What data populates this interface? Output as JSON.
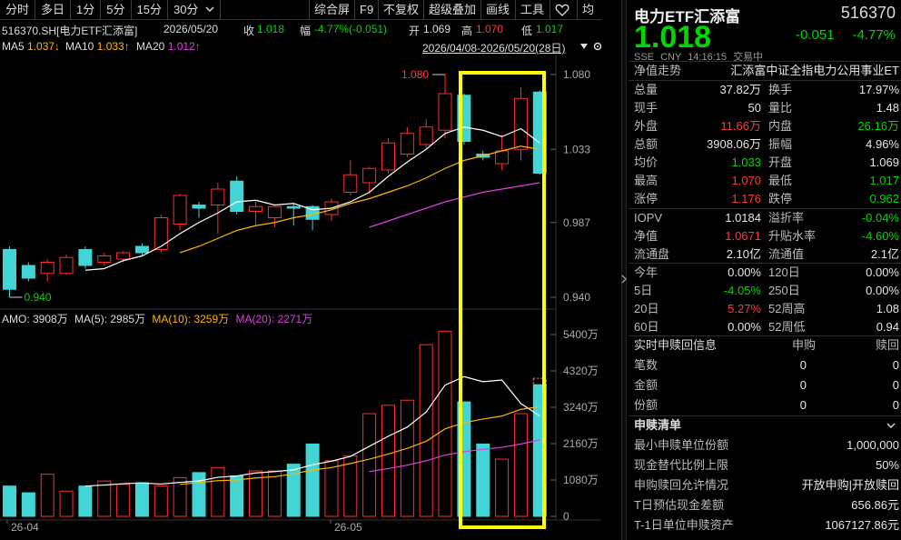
{
  "toolbar": {
    "periods": [
      "分时",
      "多日",
      "1分",
      "5分",
      "15分",
      "30分"
    ],
    "period_dropdown_icon": "chevron-down",
    "tools": [
      "综合屏",
      "F9",
      "不复权",
      "超级叠加",
      "画线",
      "工具"
    ],
    "heart_icon": "heart-outline",
    "mode_label": "均"
  },
  "info": {
    "code": "516370.SH[电力ETF汇添富]",
    "date": "2026/05/20",
    "close_label": "收",
    "close": "1.018",
    "amp_label": "幅",
    "amp": "-4.77%(-0.051)",
    "open_label": "开",
    "open": "1.069",
    "high_label": "高",
    "high": "1.070",
    "low_label": "低",
    "low": "1.017"
  },
  "ma": {
    "ma5": "MA5 1.037↓",
    "ma10": "MA10 1.033↑",
    "ma20": "MA20 1.012↑",
    "range": "2026/04/08-2026/05/20(28日)",
    "range_dropdown_icon": "triangle-down",
    "settings_icon": "gear",
    "colors": {
      "ma5": "#ffffff",
      "ma10": "#ffb400",
      "ma20": "#e040e0"
    }
  },
  "price_axis": [
    "1.080",
    "1.033",
    "0.987",
    "0.940"
  ],
  "vol_axis": [
    "5400万",
    "4320万",
    "3240万",
    "2160万",
    "1080万",
    "0"
  ],
  "date_labels": [
    "26-04",
    "26-05"
  ],
  "amo": {
    "amo": "AMO: 3908万",
    "ma5": "MA(5): 2985万",
    "ma10": "MA(10): 3259万",
    "ma20": "MA(20): 2271万"
  },
  "colors": {
    "up": "#ff2d2d",
    "down": "#43d5d5",
    "highlight": "#ffff00",
    "bg": "#000000"
  },
  "chart_data": {
    "type": "candlestick",
    "y_range": [
      0.93,
      1.09
    ],
    "annotations": {
      "high": "1.080",
      "low": "0.940"
    },
    "candles": [
      {
        "o": 0.97,
        "c": 0.945,
        "h": 0.972,
        "l": 0.94
      },
      {
        "o": 0.96,
        "c": 0.952,
        "h": 0.962,
        "l": 0.95
      },
      {
        "o": 0.955,
        "c": 0.962,
        "h": 0.964,
        "l": 0.95
      },
      {
        "o": 0.955,
        "c": 0.965,
        "h": 0.967,
        "l": 0.954
      },
      {
        "o": 0.97,
        "c": 0.96,
        "h": 0.972,
        "l": 0.958
      },
      {
        "o": 0.962,
        "c": 0.966,
        "h": 0.968,
        "l": 0.96
      },
      {
        "o": 0.964,
        "c": 0.968,
        "h": 0.969,
        "l": 0.962
      },
      {
        "o": 0.972,
        "c": 0.968,
        "h": 0.974,
        "l": 0.966
      },
      {
        "o": 0.97,
        "c": 0.99,
        "h": 0.992,
        "l": 0.968
      },
      {
        "o": 0.986,
        "c": 1.004,
        "h": 1.005,
        "l": 0.982
      },
      {
        "o": 0.998,
        "c": 0.996,
        "h": 1.0,
        "l": 0.99
      },
      {
        "o": 0.998,
        "c": 1.008,
        "h": 1.012,
        "l": 0.98
      },
      {
        "o": 1.013,
        "c": 0.994,
        "h": 1.016,
        "l": 0.992
      },
      {
        "o": 0.994,
        "c": 0.997,
        "h": 1.0,
        "l": 0.985
      },
      {
        "o": 0.99,
        "c": 0.997,
        "h": 0.998,
        "l": 0.984
      },
      {
        "o": 0.997,
        "c": 0.996,
        "h": 0.999,
        "l": 0.985
      },
      {
        "o": 0.997,
        "c": 0.989,
        "h": 0.998,
        "l": 0.982
      },
      {
        "o": 0.992,
        "c": 1.0,
        "h": 1.002,
        "l": 0.988
      },
      {
        "o": 1.006,
        "c": 1.017,
        "h": 1.026,
        "l": 1.004
      },
      {
        "o": 1.012,
        "c": 1.021,
        "h": 1.022,
        "l": 1.005
      },
      {
        "o": 1.02,
        "c": 1.037,
        "h": 1.04,
        "l": 1.018
      },
      {
        "o": 1.03,
        "c": 1.043,
        "h": 1.047,
        "l": 1.028
      },
      {
        "o": 1.036,
        "c": 1.047,
        "h": 1.052,
        "l": 1.034
      },
      {
        "o": 1.045,
        "c": 1.068,
        "h": 1.08,
        "l": 1.04
      },
      {
        "o": 1.067,
        "c": 1.038,
        "h": 1.068,
        "l": 1.036
      },
      {
        "o": 1.03,
        "c": 1.028,
        "h": 1.032,
        "l": 1.026
      },
      {
        "o": 1.024,
        "c": 1.032,
        "h": 1.042,
        "l": 1.02
      },
      {
        "o": 1.033,
        "c": 1.065,
        "h": 1.072,
        "l": 1.026
      },
      {
        "o": 1.069,
        "c": 1.018,
        "h": 1.07,
        "l": 1.017
      }
    ],
    "ma5": [
      null,
      null,
      null,
      null,
      0.957,
      0.958,
      0.963,
      0.966,
      0.972,
      0.98,
      0.987,
      0.993,
      1.0,
      1.001,
      0.998,
      0.999,
      0.995,
      0.996,
      1.0,
      1.006,
      1.016,
      1.025,
      1.033,
      1.043,
      1.047,
      1.045,
      1.041,
      1.046,
      1.037
    ],
    "ma10": [
      null,
      null,
      null,
      null,
      null,
      null,
      null,
      null,
      null,
      0.968,
      0.972,
      0.977,
      0.982,
      0.985,
      0.987,
      0.99,
      0.992,
      0.995,
      0.999,
      1.002,
      1.006,
      1.01,
      1.015,
      1.021,
      1.026,
      1.029,
      1.032,
      1.035,
      1.033
    ],
    "ma20": [
      null,
      null,
      null,
      null,
      null,
      null,
      null,
      null,
      null,
      null,
      null,
      null,
      null,
      null,
      null,
      null,
      null,
      null,
      null,
      0.984,
      0.988,
      0.992,
      0.996,
      1.0,
      1.003,
      1.006,
      1.008,
      1.01,
      1.012
    ],
    "volume_wan": [
      900,
      700,
      1250,
      750,
      900,
      1050,
      950,
      1000,
      900,
      1150,
      1300,
      1450,
      1200,
      1350,
      1350,
      1550,
      2150,
      1650,
      1800,
      3050,
      3300,
      3450,
      5100,
      5500,
      3400,
      2150,
      1700,
      3050,
      3908
    ],
    "volume_prev_marker_wan": 4100,
    "vol_ma5": [
      null,
      null,
      null,
      null,
      900,
      930,
      970,
      990,
      960,
      1010,
      1050,
      1160,
      1200,
      1290,
      1330,
      1380,
      1530,
      1640,
      1780,
      2080,
      2380,
      2650,
      3100,
      3900,
      4150,
      4000,
      4050,
      3350,
      2985
    ],
    "vol_ma10": [
      null,
      null,
      null,
      null,
      null,
      null,
      null,
      null,
      null,
      950,
      1000,
      1060,
      1080,
      1140,
      1180,
      1260,
      1380,
      1450,
      1570,
      1700,
      1850,
      2020,
      2230,
      2600,
      2780,
      2890,
      2980,
      3180,
      3259
    ],
    "vol_ma20": [
      null,
      null,
      null,
      null,
      null,
      null,
      null,
      null,
      null,
      null,
      null,
      null,
      null,
      null,
      null,
      null,
      null,
      null,
      null,
      1330,
      1420,
      1520,
      1650,
      1820,
      1920,
      1990,
      2050,
      2150,
      2271
    ],
    "y_ticks": [
      "1.080",
      "1.033",
      "0.987",
      "0.940"
    ],
    "x_labels": [
      "26-04",
      "26-05"
    ]
  },
  "quote": {
    "name": "电力ETF汇添富",
    "code": "516370",
    "price": "1.018",
    "change": "-0.051",
    "pct": "-4.77%",
    "sub": [
      "SSE",
      "CNY",
      "14:16:15",
      "交易中"
    ],
    "tracking": "净值走势",
    "tracking_index": "汇添富中证全指电力公用事业ET"
  },
  "stats": [
    {
      "k1": "总量",
      "v1": "37.82万",
      "c1": "wht",
      "k2": "换手",
      "v2": "17.97%",
      "c2": "wht"
    },
    {
      "k1": "现手",
      "v1": "50",
      "c1": "wht",
      "k2": "量比",
      "v2": "1.48",
      "c2": "wht"
    },
    {
      "k1": "外盘",
      "v1": "11.66万",
      "c1": "red",
      "k2": "内盘",
      "v2": "26.16万",
      "c2": "grn"
    },
    {
      "k1": "总额",
      "v1": "3908.06万",
      "c1": "wht",
      "k2": "振幅",
      "v2": "4.96%",
      "c2": "wht"
    },
    {
      "k1": "均价",
      "v1": "1.033",
      "c1": "grn",
      "k2": "开盘",
      "v2": "1.069",
      "c2": "wht"
    },
    {
      "k1": "最高",
      "v1": "1.070",
      "c1": "red",
      "k2": "最低",
      "v2": "1.017",
      "c2": "grn"
    },
    {
      "k1": "涨停",
      "v1": "1.176",
      "c1": "red",
      "k2": "跌停",
      "v2": "0.962",
      "c2": "grn"
    }
  ],
  "nav": [
    {
      "k1": "IOPV",
      "v1": "1.0184",
      "c1": "wht",
      "k2": "溢折率",
      "v2": "-0.04%",
      "c2": "grn"
    },
    {
      "k1": "净值",
      "v1": "1.0671",
      "c1": "red",
      "k2": "升贴水率",
      "v2": "-4.60%",
      "c2": "grn"
    },
    {
      "k1": "流通盘",
      "v1": "2.10亿",
      "c1": "wht",
      "k2": "流通值",
      "v2": "2.1亿",
      "c2": "wht"
    }
  ],
  "perf": [
    {
      "k1": "今年",
      "v1": "0.00%",
      "c1": "wht",
      "k2": "120日",
      "v2": "0.00%",
      "c2": "wht"
    },
    {
      "k1": "5日",
      "v1": "-4.05%",
      "c1": "grn",
      "k2": "250日",
      "v2": "0.00%",
      "c2": "wht"
    },
    {
      "k1": "20日",
      "v1": "5.27%",
      "c1": "red",
      "k2": "52周高",
      "v2": "1.08",
      "c2": "wht"
    },
    {
      "k1": "60日",
      "v1": "0.00%",
      "c1": "wht",
      "k2": "52周低",
      "v2": "0.94",
      "c2": "wht"
    }
  ],
  "subs": {
    "title": "实时申赎回信息",
    "col1": "申购",
    "col2": "赎回",
    "rows": [
      {
        "k": "笔数",
        "a": "0",
        "b": "0"
      },
      {
        "k": "金额",
        "a": "0",
        "b": "0"
      },
      {
        "k": "份额",
        "a": "0",
        "b": "0"
      }
    ]
  },
  "list": {
    "title": "申赎清单",
    "title_icon": "chevron-down",
    "rows": [
      {
        "k": "最小申赎单位份额",
        "v": "1,000,000"
      },
      {
        "k": "现金替代比例上限",
        "v": "50%"
      },
      {
        "k": "申购赎回允许情况",
        "v": "开放申购|开放赎回"
      },
      {
        "k": "T日预估现金差额",
        "v": "656.86元"
      },
      {
        "k": "T-1日单位申赎资产",
        "v": "1067127.86元"
      }
    ]
  },
  "collapse_icon": "chevron-right"
}
